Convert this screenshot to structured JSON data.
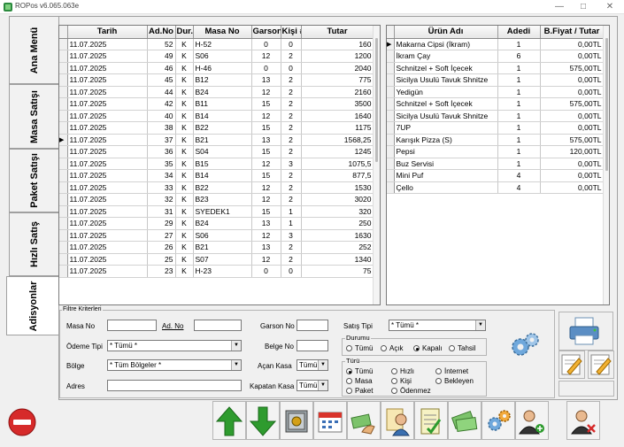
{
  "window": {
    "title": "ROPos v6.065.063e"
  },
  "tabs": [
    "Ana Menü",
    "Masa Satışı",
    "Paket Satışı",
    "Hızlı Satış",
    "Adisyonlar"
  ],
  "orders": {
    "columns": [
      "Tarih",
      "Ad.No",
      "Dur.",
      "Masa No",
      "Garson",
      "Kişi #",
      "Tutar"
    ],
    "selected_row": 8,
    "rows": [
      [
        "11.07.2025",
        "52",
        "K",
        "H-52",
        "0",
        "0",
        "160"
      ],
      [
        "11.07.2025",
        "49",
        "K",
        "S06",
        "12",
        "2",
        "1200"
      ],
      [
        "11.07.2025",
        "46",
        "K",
        "H-46",
        "0",
        "0",
        "2040"
      ],
      [
        "11.07.2025",
        "45",
        "K",
        "B12",
        "13",
        "2",
        "775"
      ],
      [
        "11.07.2025",
        "44",
        "K",
        "B24",
        "12",
        "2",
        "2160"
      ],
      [
        "11.07.2025",
        "42",
        "K",
        "B11",
        "15",
        "2",
        "3500"
      ],
      [
        "11.07.2025",
        "40",
        "K",
        "B14",
        "12",
        "2",
        "1640"
      ],
      [
        "11.07.2025",
        "38",
        "K",
        "B22",
        "15",
        "2",
        "1175"
      ],
      [
        "11.07.2025",
        "37",
        "K",
        "B21",
        "13",
        "2",
        "1568,25"
      ],
      [
        "11.07.2025",
        "36",
        "K",
        "S04",
        "15",
        "2",
        "1245"
      ],
      [
        "11.07.2025",
        "35",
        "K",
        "B15",
        "12",
        "3",
        "1075,5"
      ],
      [
        "11.07.2025",
        "34",
        "K",
        "B14",
        "15",
        "2",
        "877,5"
      ],
      [
        "11.07.2025",
        "33",
        "K",
        "B22",
        "12",
        "2",
        "1530"
      ],
      [
        "11.07.2025",
        "32",
        "K",
        "B23",
        "12",
        "2",
        "3020"
      ],
      [
        "11.07.2025",
        "31",
        "K",
        "SYEDEK1",
        "15",
        "1",
        "320"
      ],
      [
        "11.07.2025",
        "29",
        "K",
        "B24",
        "13",
        "1",
        "250"
      ],
      [
        "11.07.2025",
        "27",
        "K",
        "S06",
        "12",
        "3",
        "1630"
      ],
      [
        "11.07.2025",
        "26",
        "K",
        "B21",
        "13",
        "2",
        "252"
      ],
      [
        "11.07.2025",
        "25",
        "K",
        "S07",
        "12",
        "2",
        "1340"
      ],
      [
        "11.07.2025",
        "23",
        "K",
        "H-23",
        "0",
        "0",
        "75"
      ]
    ]
  },
  "products": {
    "columns": [
      "Ürün Adı",
      "Adedi",
      "B.Fiyat / Tutar"
    ],
    "rows": [
      [
        "Makarna Cipsi (İkram)",
        "1",
        "0,00TL"
      ],
      [
        "İkram Çay",
        "6",
        "0,00TL"
      ],
      [
        "Schnitzel + Soft İçecek",
        "1",
        "575,00TL"
      ],
      [
        "Sicilya Usulü Tavuk Shnitze",
        "1",
        "0,00TL"
      ],
      [
        "Yedigün",
        "1",
        "0,00TL"
      ],
      [
        "Schnitzel + Soft İçecek",
        "1",
        "575,00TL"
      ],
      [
        "Sicilya Usulü Tavuk Shnitze",
        "1",
        "0,00TL"
      ],
      [
        "7UP",
        "1",
        "0,00TL"
      ],
      [
        "Karışık Pizza (S)",
        "1",
        "575,00TL"
      ],
      [
        "Pepsi",
        "1",
        "120,00TL"
      ],
      [
        "Buz Servisi",
        "1",
        "0,00TL"
      ],
      [
        "Mini Puf",
        "4",
        "0,00TL"
      ],
      [
        "Çello",
        "4",
        "0,00TL"
      ]
    ]
  },
  "filter": {
    "title": "Filtre Kriterleri",
    "masa_no": "Masa No",
    "ad_no": "Ad. No",
    "garson_no": "Garson No",
    "satis_tipi": "Satış Tipi",
    "satis_tipi_value": "* Tümü *",
    "odeme_tipi": "Ödeme Tipi",
    "odeme_tipi_value": "* Tümü *",
    "belge_no": "Belge No",
    "bolge": "Bölge",
    "bolge_value": "* Tüm Bölgeler *",
    "acan_kasa": "Açan Kasa",
    "acan_kasa_value": "Tümü",
    "adres": "Adres",
    "kapatan_kasa": "Kapatan Kasa",
    "kapatan_kasa_value": "Tümü",
    "durumu": {
      "label": "Durumu",
      "options": [
        "Tümü",
        "Açık",
        "Kapalı",
        "Tahsil"
      ],
      "selected": "Kapalı"
    },
    "turu": {
      "label": "Türü",
      "options": [
        "Tümü",
        "Hızlı",
        "İnternet",
        "Masa",
        "Kişi",
        "Bekleyen",
        "Paket",
        "Ödenmez"
      ],
      "selected": "Tümü"
    }
  },
  "icons": {
    "toolbar": [
      "stop-icon",
      "arrow-up-icon",
      "arrow-down-icon",
      "safe-icon",
      "calendar-icon",
      "payment-icon",
      "waiter-icon",
      "checklist-icon",
      "money-icon",
      "gears-icon",
      "user-add-icon",
      "user-remove-icon"
    ],
    "side": [
      "settings-gears-icon",
      "printer-icon",
      "edit-icon",
      "edit-alt-icon"
    ]
  },
  "colors": {
    "grid_header": "#e6e6e6",
    "grid_border": "#7a7a7a",
    "up_arrow": "#2e9b2e",
    "stop": "#d62a2a"
  }
}
